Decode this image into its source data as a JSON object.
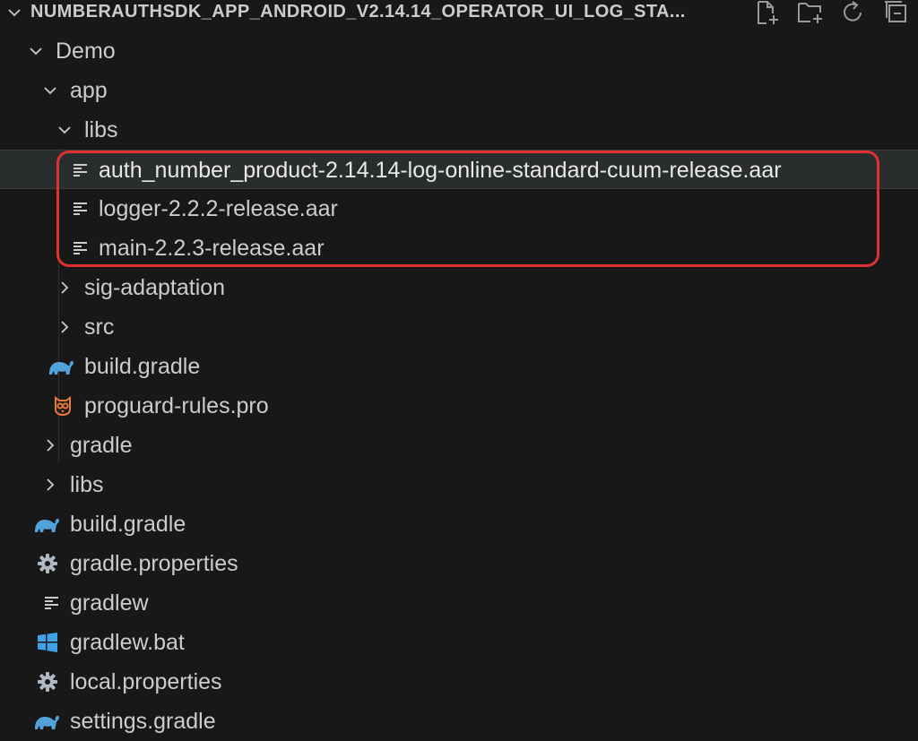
{
  "explorer": {
    "title": "NUMBERAUTHSDK_APP_ANDROID_V2.14.14_OPERATOR_UI_LOG_STA...",
    "actions": [
      {
        "icon": "new-file-icon"
      },
      {
        "icon": "new-folder-icon"
      },
      {
        "icon": "refresh-icon"
      },
      {
        "icon": "collapse-all-icon"
      }
    ]
  },
  "tree": {
    "items": [
      {
        "label": "Demo",
        "type": "folder",
        "expanded": true
      },
      {
        "label": "app",
        "type": "folder",
        "expanded": true
      },
      {
        "label": "libs",
        "type": "folder",
        "expanded": true
      },
      {
        "label": "auth_number_product-2.14.14-log-online-standard-cuum-release.aar",
        "type": "file",
        "icon": "text-file-icon",
        "selected": true
      },
      {
        "label": "logger-2.2.2-release.aar",
        "type": "file",
        "icon": "text-file-icon"
      },
      {
        "label": "main-2.2.3-release.aar",
        "type": "file",
        "icon": "text-file-icon"
      },
      {
        "label": "sig-adaptation",
        "type": "folder",
        "expanded": false
      },
      {
        "label": "src",
        "type": "folder",
        "expanded": false
      },
      {
        "label": "build.gradle",
        "type": "file",
        "icon": "gradle-icon"
      },
      {
        "label": "proguard-rules.pro",
        "type": "file",
        "icon": "proguard-owl-icon"
      },
      {
        "label": "gradle",
        "type": "folder",
        "expanded": false
      },
      {
        "label": "libs",
        "type": "folder",
        "expanded": false
      },
      {
        "label": "build.gradle",
        "type": "file",
        "icon": "gradle-icon"
      },
      {
        "label": "gradle.properties",
        "type": "file",
        "icon": "gear-icon"
      },
      {
        "label": "gradlew",
        "type": "file",
        "icon": "text-file-icon"
      },
      {
        "label": "gradlew.bat",
        "type": "file",
        "icon": "windows-icon"
      },
      {
        "label": "local.properties",
        "type": "file",
        "icon": "gear-icon"
      },
      {
        "label": "settings.gradle",
        "type": "file",
        "icon": "gradle-icon"
      }
    ]
  },
  "colors": {
    "background": "#181818",
    "text": "#cccccc",
    "selection": "#2a2d2e",
    "highlight_border": "#e03131",
    "gradle_icon": "#4fa3d9",
    "proguard_icon": "#e8773a",
    "gear_icon": "#aeb9c4",
    "windows_icon": "#3fa2e6"
  }
}
